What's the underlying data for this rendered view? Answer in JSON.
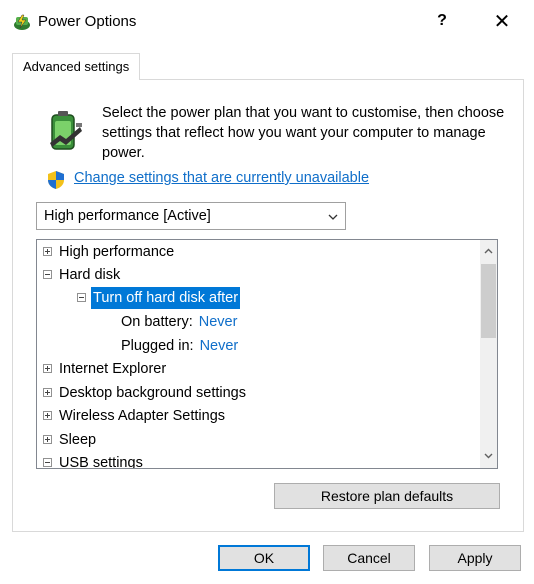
{
  "window": {
    "title": "Power Options",
    "help": "?",
    "close": "✕"
  },
  "tab": {
    "label": "Advanced settings"
  },
  "intro": {
    "text": "Select the power plan that you want to customise, then choose settings that reflect how you want your computer to manage power."
  },
  "link": {
    "label": "Change settings that are currently unavailable"
  },
  "plan_select": {
    "selected": "High performance [Active]"
  },
  "tree": {
    "items": [
      {
        "label": "High performance"
      },
      {
        "label": "Hard disk"
      },
      {
        "label": "Turn off hard disk after"
      },
      {
        "label": "On battery:",
        "value": "Never"
      },
      {
        "label": "Plugged in:",
        "value": "Never"
      },
      {
        "label": "Internet Explorer"
      },
      {
        "label": "Desktop background settings"
      },
      {
        "label": "Wireless Adapter Settings"
      },
      {
        "label": "Sleep"
      },
      {
        "label": "USB settings"
      }
    ]
  },
  "buttons": {
    "restore": "Restore plan defaults",
    "ok": "OK",
    "cancel": "Cancel",
    "apply": "Apply"
  },
  "colors": {
    "accent": "#0078d7",
    "link": "#0f6ec9"
  }
}
